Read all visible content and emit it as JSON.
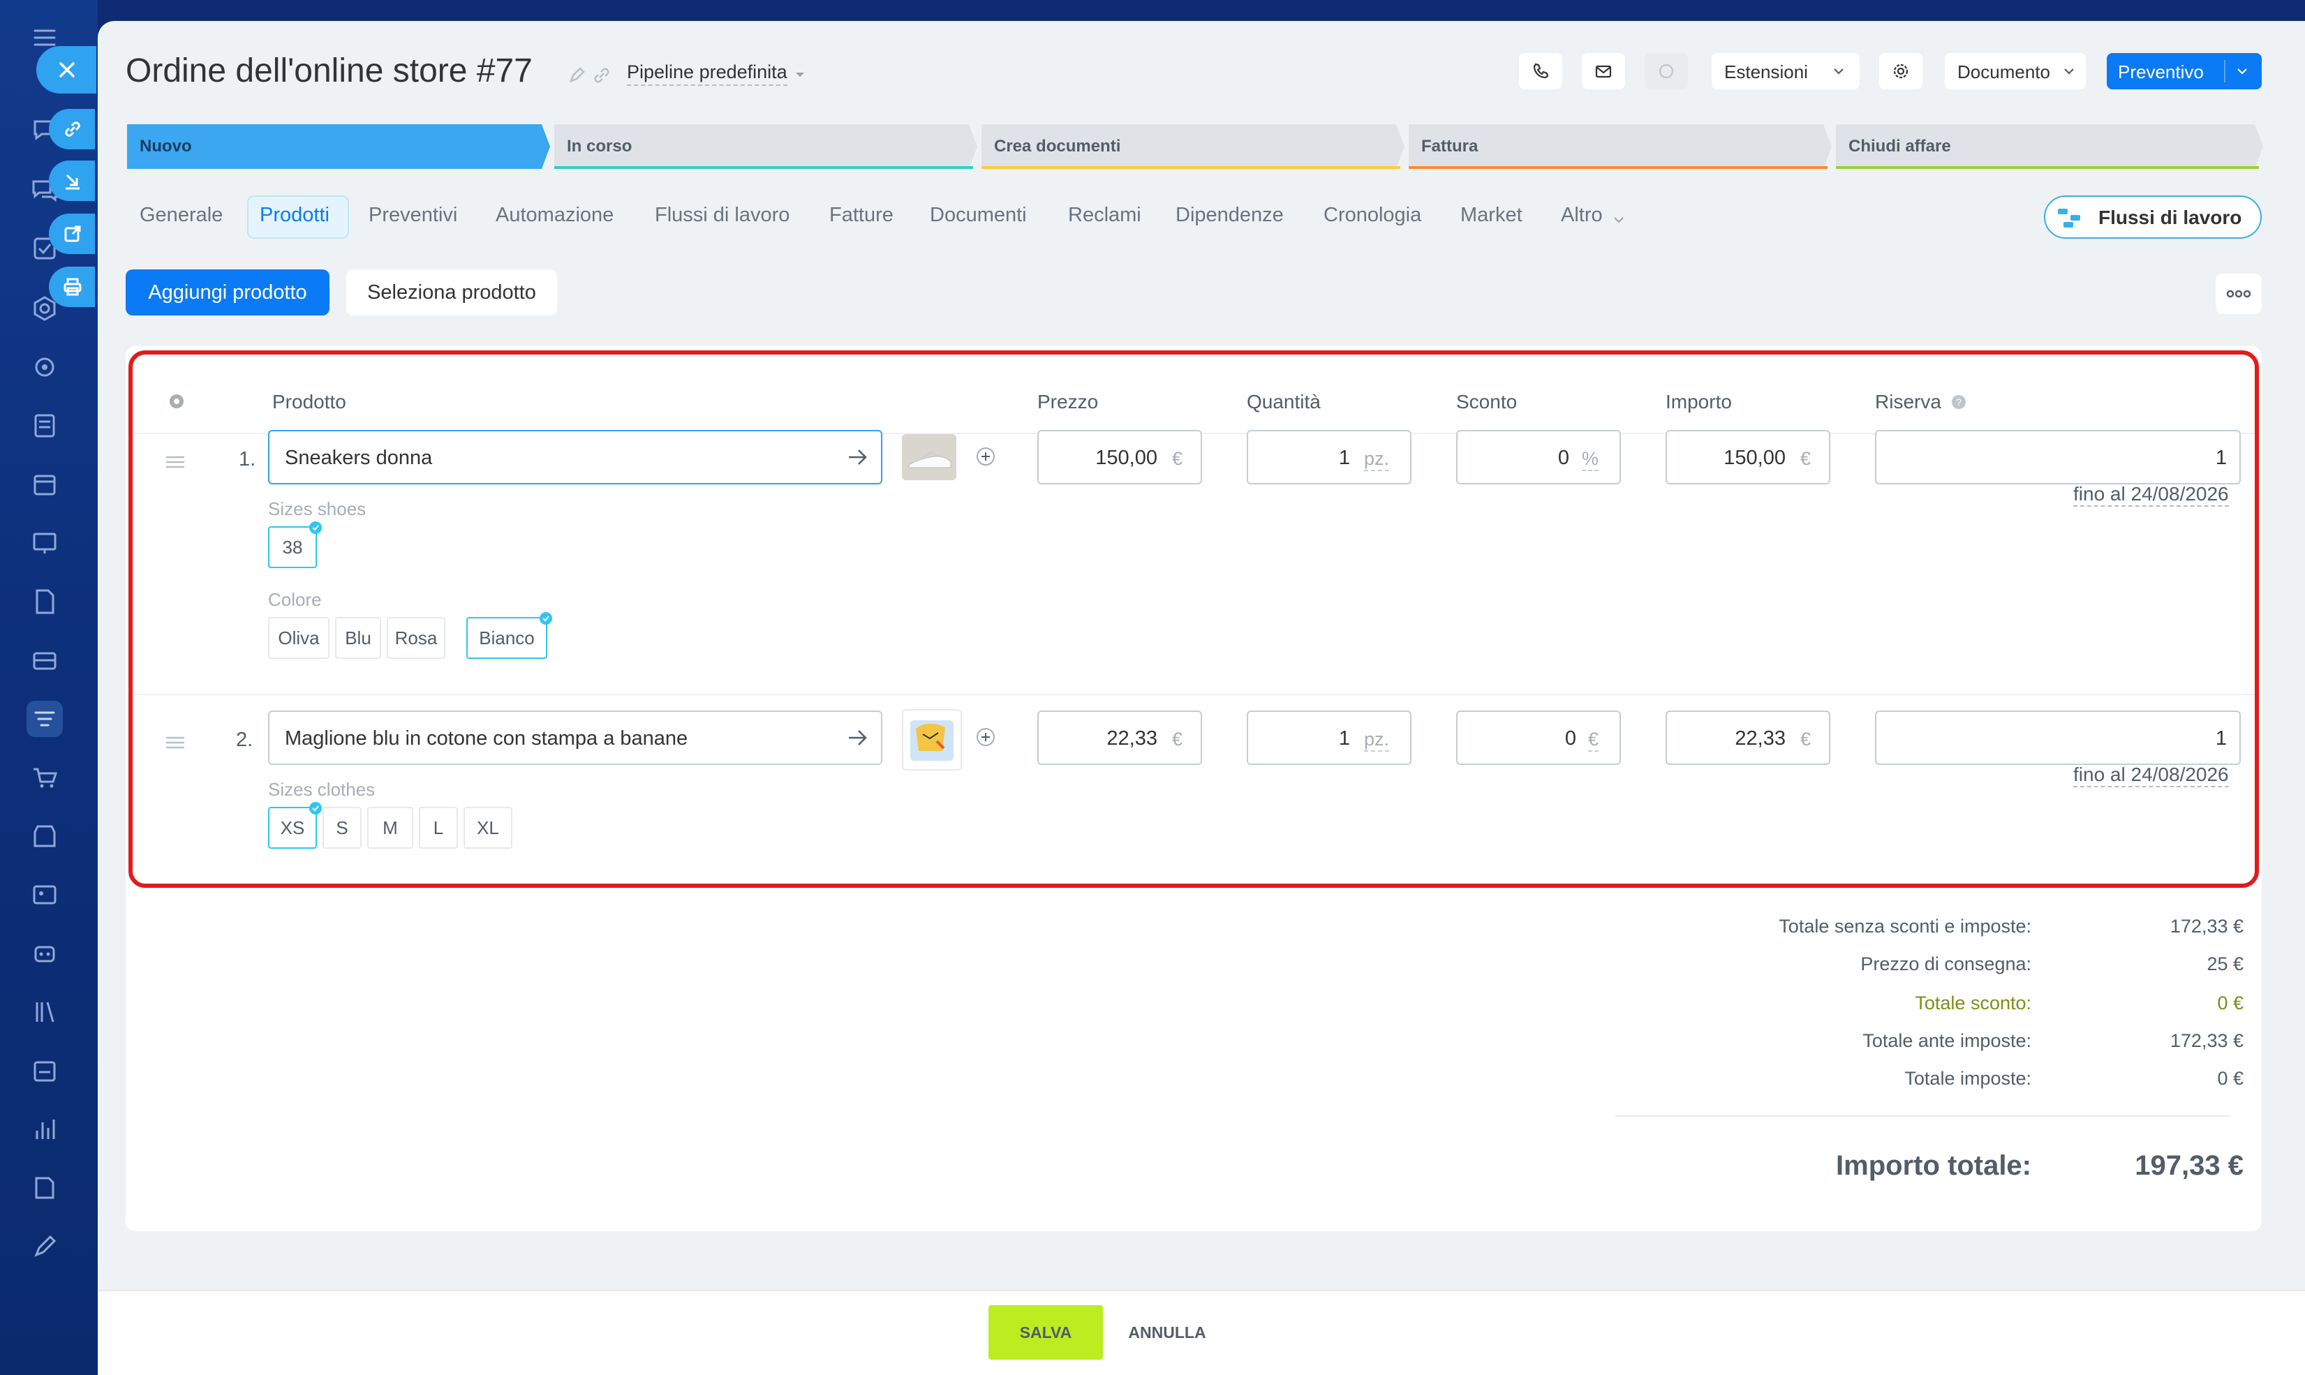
{
  "header": {
    "title": "Ordine dell'online store #77",
    "pipeline": "Pipeline predefinita",
    "extensions_label": "Estensioni",
    "document_label": "Documento",
    "quote_label": "Preventivo"
  },
  "stages": [
    {
      "label": "Nuovo",
      "color": "#3aa7f0",
      "active": true
    },
    {
      "label": "In corso",
      "color": "#2fd1c4",
      "active": false
    },
    {
      "label": "Crea documenti",
      "color": "#ffcb3d",
      "active": false
    },
    {
      "label": "Fattura",
      "color": "#ff8b2a",
      "active": false
    },
    {
      "label": "Chiudi affare",
      "color": "#9bd13a",
      "active": false
    }
  ],
  "tabs": [
    {
      "label": "Generale"
    },
    {
      "label": "Prodotti",
      "active": true
    },
    {
      "label": "Preventivi"
    },
    {
      "label": "Automazione"
    },
    {
      "label": "Flussi di lavoro"
    },
    {
      "label": "Fatture"
    },
    {
      "label": "Documenti"
    },
    {
      "label": "Reclami"
    },
    {
      "label": "Dipendenze"
    },
    {
      "label": "Cronologia"
    },
    {
      "label": "Market"
    },
    {
      "label": "Altro"
    }
  ],
  "workflow_button": "Flussi di lavoro",
  "actions": {
    "add_product": "Aggiungi prodotto",
    "select_product": "Seleziona prodotto"
  },
  "table": {
    "columns": [
      "Prodotto",
      "Prezzo",
      "Quantità",
      "Sconto",
      "Importo",
      "Riserva"
    ],
    "rows": [
      {
        "num": "1.",
        "name": "Sneakers donna",
        "price": "150,00",
        "price_unit": "€",
        "qty": "1",
        "qty_unit": "pz.",
        "discount": "0",
        "discount_unit": "%",
        "amount": "150,00",
        "amount_unit": "€",
        "reserve": "1",
        "reserve_until": "fino al 24/08/2026",
        "prop1_label": "Sizes shoes",
        "prop1_options": [
          "38"
        ],
        "prop2_label": "Colore",
        "prop2_options": [
          "Oliva",
          "Blu",
          "Rosa",
          "Bianco"
        ]
      },
      {
        "num": "2.",
        "name": "Maglione blu in cotone con stampa a banane",
        "price": "22,33",
        "price_unit": "€",
        "qty": "1",
        "qty_unit": "pz.",
        "discount": "0",
        "discount_unit": "€",
        "amount": "22,33",
        "amount_unit": "€",
        "reserve": "1",
        "reserve_until": "fino al 24/08/2026",
        "prop1_label": "Sizes clothes",
        "prop1_options": [
          "XS",
          "S",
          "M",
          "L",
          "XL"
        ]
      }
    ]
  },
  "totals": {
    "rows": [
      {
        "label": "Totale senza sconti e imposte:",
        "value": "172,33 €"
      },
      {
        "label": "Prezzo di consegna:",
        "value": "25 €"
      },
      {
        "label": "Totale sconto:",
        "value": "0 €"
      },
      {
        "label": "Totale ante imposte:",
        "value": "172,33 €"
      },
      {
        "label": "Totale imposte:",
        "value": "0 €"
      }
    ],
    "grand_label": "Importo totale:",
    "grand_value": "197,33 €",
    "discount_color": "#7a8f1b"
  },
  "footer": {
    "save": "SALVA",
    "cancel": "ANNULLA"
  },
  "colors": {
    "accent": "#0b7af5",
    "highlight": "#e11b1b",
    "save": "#bbed21"
  }
}
